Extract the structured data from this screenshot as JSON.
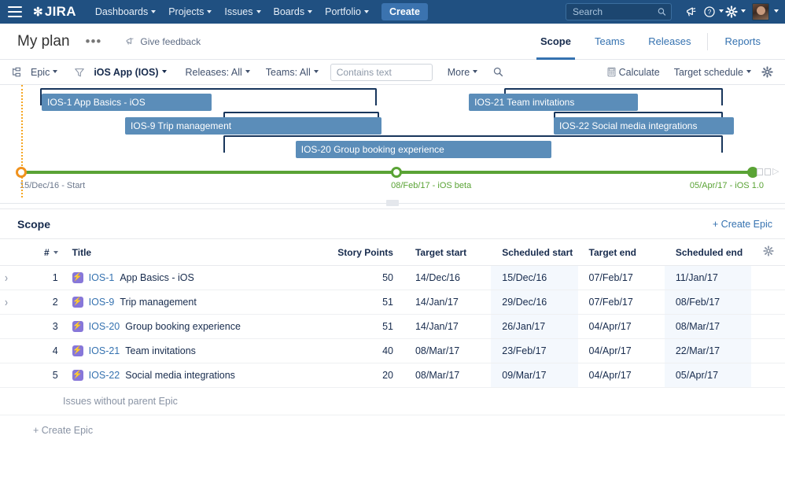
{
  "topnav": {
    "menu_icon": "hamburger-icon",
    "logo_text": "JIRA",
    "items": [
      {
        "label": "Dashboards"
      },
      {
        "label": "Projects"
      },
      {
        "label": "Issues"
      },
      {
        "label": "Boards"
      },
      {
        "label": "Portfolio"
      }
    ],
    "create_label": "Create",
    "search_placeholder": "Search",
    "search_value": "",
    "icons": [
      "megaphone-icon",
      "help-icon",
      "settings-gear-icon",
      "avatar"
    ],
    "background_color": "#205081",
    "create_button_color": "#3b73af"
  },
  "planheader": {
    "title": "My plan",
    "more_label": "•••",
    "feedback_label": "Give feedback",
    "tabs": [
      {
        "label": "Scope",
        "active": true
      },
      {
        "label": "Teams",
        "active": false
      },
      {
        "label": "Releases",
        "active": false
      },
      {
        "label": "Reports",
        "active": false
      }
    ],
    "active_tab_color": "#3572b0"
  },
  "toolbar": {
    "hierarchy_label": "Epic",
    "filter_label": "iOS App (IOS)",
    "releases_label": "Releases: All",
    "teams_label": "Teams: All",
    "contains_placeholder": "Contains text",
    "contains_value": "",
    "more_label": "More",
    "search_icon": "search-icon",
    "calculate_label": "Calculate",
    "schedule_label": "Target schedule",
    "settings_icon": "settings-gear-icon"
  },
  "timeline": {
    "bars": [
      {
        "key": "IOS-1",
        "label": "IOS-1 App Basics - iOS",
        "target_left_pct": 2.6,
        "target_width_pct": 46.0,
        "sched_left_pct": 2.8,
        "sched_width_pct": 23.2
      },
      {
        "key": "IOS-9",
        "label": "IOS-9 Trip management",
        "target_left_pct": 27.6,
        "target_width_pct": 21.3,
        "sched_left_pct": 14.2,
        "sched_width_pct": 35.0
      },
      {
        "key": "IOS-20",
        "label": "IOS-20 Group booking experience",
        "target_left_pct": 27.6,
        "target_width_pct": 68.3,
        "sched_left_pct": 37.5,
        "sched_width_pct": 35.0
      },
      {
        "key": "IOS-21",
        "label": "IOS-21 Team invitations",
        "target_left_pct": 66.0,
        "target_width_pct": 29.9,
        "sched_left_pct": 61.2,
        "sched_width_pct": 23.1
      },
      {
        "key": "IOS-22",
        "label": "IOS-22 Social media integrations",
        "target_left_pct": 72.8,
        "target_width_pct": 23.1,
        "sched_left_pct": 72.8,
        "sched_width_pct": 24.6
      }
    ],
    "axis": {
      "line_color": "#5aa335",
      "markers": [
        {
          "label": "15/Dec/16 - Start",
          "left_pct": 0.0,
          "style": "ring-orange",
          "label_color": "grey"
        },
        {
          "label": "08/Feb/17 - iOS beta",
          "left_pct": 51.3,
          "style": "ring-green",
          "label_color": "green"
        },
        {
          "label": "05/Apr/17 - iOS 1.0",
          "left_pct": 100.0,
          "style": "solid-green",
          "label_color": "green"
        }
      ],
      "start_marker_color": "#f0921e",
      "milestone_color": "#5aa335"
    }
  },
  "scope": {
    "title": "Scope",
    "create_epic_top_label": "+ Create Epic",
    "create_epic_bottom_label": "+ Create Epic",
    "no_parent_label": "Issues without parent Epic",
    "columns": [
      {
        "label": "#",
        "sortable": true
      },
      {
        "label": "Title"
      },
      {
        "label": "Story Points"
      },
      {
        "label": "Target start"
      },
      {
        "label": "Scheduled start"
      },
      {
        "label": "Target end"
      },
      {
        "label": "Scheduled end"
      }
    ],
    "rows": [
      {
        "expandable": true,
        "num": "1",
        "key": "IOS-1",
        "title": "App Basics - iOS",
        "story_points": "50",
        "target_start": "14/Dec/16",
        "scheduled_start": "15/Dec/16",
        "target_end": "07/Feb/17",
        "scheduled_end": "11/Jan/17"
      },
      {
        "expandable": true,
        "num": "2",
        "key": "IOS-9",
        "title": "Trip management",
        "story_points": "51",
        "target_start": "14/Jan/17",
        "scheduled_start": "29/Dec/16",
        "target_end": "07/Feb/17",
        "scheduled_end": "08/Feb/17"
      },
      {
        "expandable": false,
        "num": "3",
        "key": "IOS-20",
        "title": "Group booking experience",
        "story_points": "51",
        "target_start": "14/Jan/17",
        "scheduled_start": "26/Jan/17",
        "target_end": "04/Apr/17",
        "scheduled_end": "08/Mar/17"
      },
      {
        "expandable": false,
        "num": "4",
        "key": "IOS-21",
        "title": "Team invitations",
        "story_points": "40",
        "target_start": "08/Mar/17",
        "scheduled_start": "23/Feb/17",
        "target_end": "04/Apr/17",
        "scheduled_end": "22/Mar/17"
      },
      {
        "expandable": false,
        "num": "5",
        "key": "IOS-22",
        "title": "Social media integrations",
        "story_points": "20",
        "target_start": "08/Mar/17",
        "scheduled_start": "09/Mar/17",
        "target_end": "04/Apr/17",
        "scheduled_end": "05/Apr/17"
      }
    ]
  },
  "colors": {
    "nav_blue": "#205081",
    "link_blue": "#3572b0",
    "bar_fill": "#5b8db9",
    "bar_outline": "#18365c",
    "epic_purple": "#8777d9",
    "tint_blue": "#f4f8fd"
  }
}
